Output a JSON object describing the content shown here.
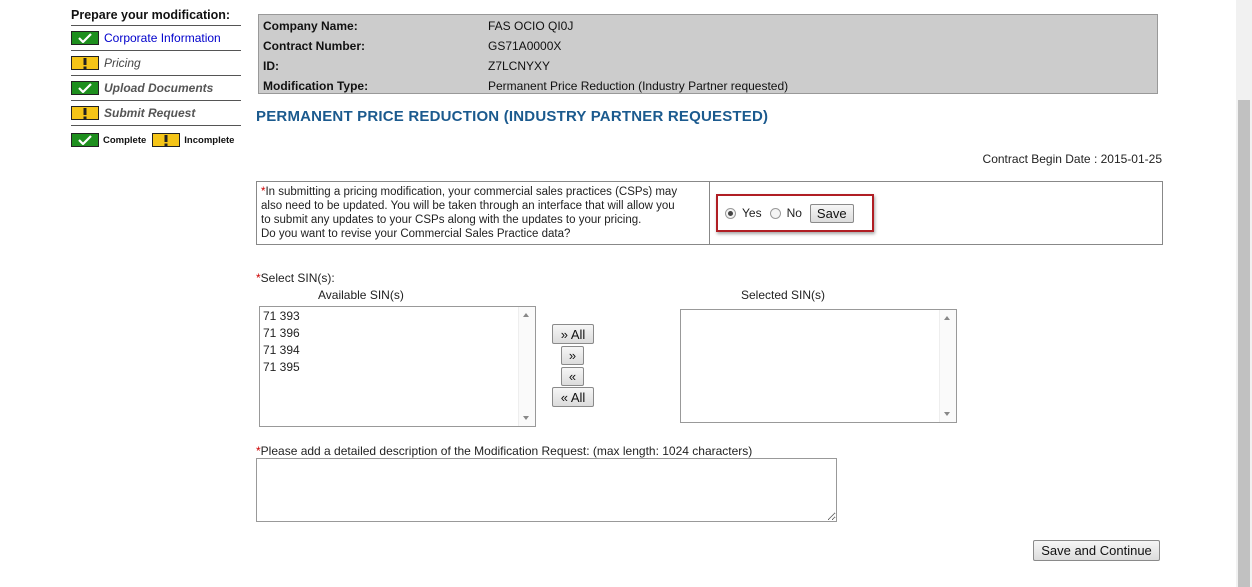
{
  "sidebar": {
    "title": "Prepare your modification:",
    "items": [
      {
        "label": "Corporate Information",
        "status": "complete"
      },
      {
        "label": "Pricing",
        "status": "incomplete"
      },
      {
        "label": "Upload Documents",
        "status": "complete"
      },
      {
        "label": "Submit Request",
        "status": "incomplete"
      }
    ],
    "legend": {
      "complete": "Complete",
      "incomplete": "Incomplete"
    }
  },
  "info": {
    "company_label": "Company Name:",
    "company_value": "FAS OCIO QI0J",
    "contract_label": "Contract Number:",
    "contract_value": "GS71A0000X",
    "id_label": "ID:",
    "id_value": "Z7LCNYXY",
    "modtype_label": "Modification Type:",
    "modtype_value": "Permanent Price Reduction (Industry Partner requested)"
  },
  "heading": "PERMANENT PRICE REDUCTION (INDUSTRY PARTNER REQUESTED)",
  "contract_begin": "Contract Begin Date : 2015-01-25",
  "csp": {
    "required_mark": "*",
    "line1": "In submitting a pricing modification, your commercial sales practices (CSPs) may",
    "line2": "also need to be updated. You will be taken through an interface that will allow you",
    "line3": "to submit any updates to your CSPs along with the updates to your pricing.",
    "line4": "Do you want to revise your Commercial Sales Practice data?",
    "yes_label": "Yes",
    "no_label": "No",
    "selected": "Yes",
    "save_label": "Save"
  },
  "sin": {
    "required_mark": "*",
    "label": "Select SIN(s):",
    "available_title": "Available SIN(s)",
    "selected_title": "Selected SIN(s)",
    "available": [
      "71 393",
      "71 396",
      "71 394",
      "71 395"
    ],
    "selected": [],
    "add_all_label": "» All",
    "add_label": "»",
    "remove_label": "«",
    "remove_all_label": "« All"
  },
  "description": {
    "required_mark": "*",
    "label": "Please add a detailed description of the Modification Request: (max length: 1024 characters)",
    "value": ""
  },
  "save_continue_label": "Save and Continue",
  "colors": {
    "heading": "#1b5a8e",
    "complete": "#1e8f1e",
    "incomplete": "#f5c518",
    "highlight": "#b01e24",
    "info_bg": "#cccccc"
  }
}
